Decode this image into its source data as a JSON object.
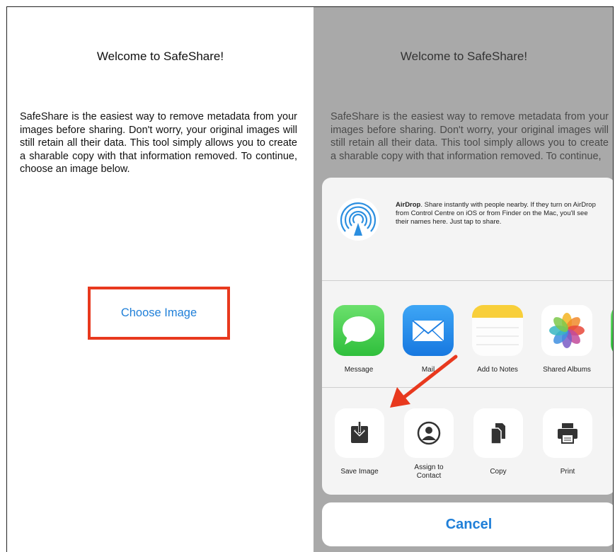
{
  "left": {
    "title": "Welcome to SafeShare!",
    "intro": "SafeShare is the easiest way to remove metadata from your images before sharing.  Don't worry, your original images will still retain all their data.  This tool simply allows you to create a sharable copy with that information removed.   To continue, choose an image below.",
    "choose_label": "Choose Image"
  },
  "right": {
    "title": "Welcome to SafeShare!",
    "intro": "SafeShare is the easiest way to remove metadata from your images before sharing.  Don't worry, your original images will still retain all their data.  This tool simply allows you to create a sharable copy with that information removed.   To continue,"
  },
  "share_sheet": {
    "airdrop_title": "AirDrop",
    "airdrop_text": ". Share instantly with people nearby. If they turn on AirDrop from Control Centre on iOS or from Finder on the Mac, you'll see their names here. Just tap to share.",
    "apps": [
      {
        "label": "Message",
        "icon": "message-icon"
      },
      {
        "label": "Mail",
        "icon": "mail-icon"
      },
      {
        "label": "Add to Notes",
        "icon": "notes-icon"
      },
      {
        "label": "Shared Albums",
        "icon": "photos-icon"
      }
    ],
    "actions": [
      {
        "label": "Save Image",
        "icon": "save-image-icon"
      },
      {
        "label": "Assign to Contact",
        "icon": "assign-contact-icon"
      },
      {
        "label": "Copy",
        "icon": "copy-icon"
      },
      {
        "label": "Print",
        "icon": "print-icon"
      }
    ],
    "cancel_label": "Cancel"
  },
  "colors": {
    "highlight": "#e8391e",
    "link": "#1f7fd8",
    "dim_overlay": "#a9a9a9"
  }
}
